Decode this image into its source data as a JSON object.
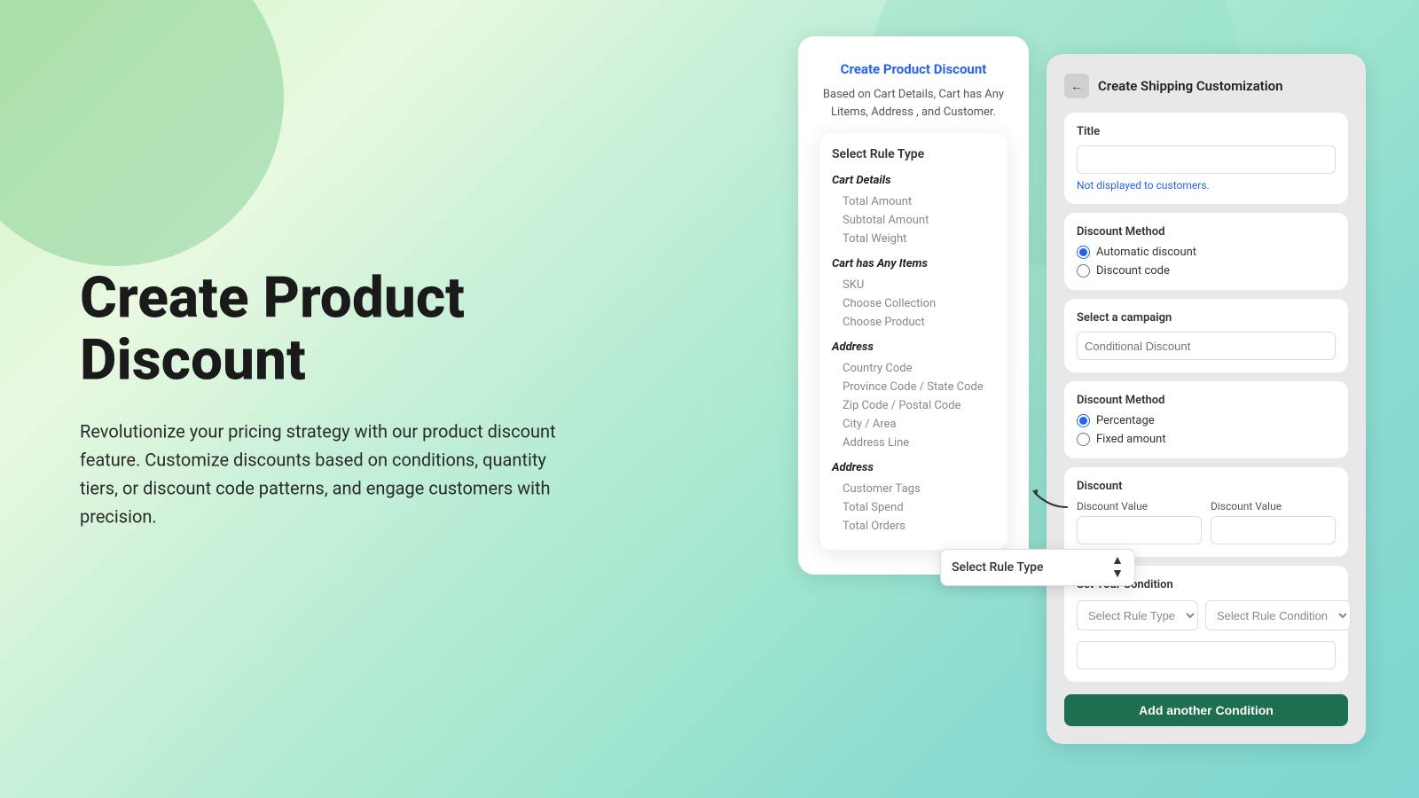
{
  "background": {
    "gradient": "linear-gradient(135deg, #d4f5c4, #7dd4d0)"
  },
  "left_section": {
    "heading": "Create Product Discount",
    "description": "Revolutionize your pricing strategy with our product discount feature. Customize discounts based on conditions, quantity tiers, or discount code patterns, and engage customers with precision."
  },
  "product_card": {
    "title": "Create Product Discount",
    "description": "Based on Cart Details, Cart has Any Litems, Address , and Customer."
  },
  "rule_type_card": {
    "section_title": "Select Rule Type",
    "categories": [
      {
        "label": "Cart Details",
        "items": [
          "Total Amount",
          "Subtotal Amount",
          "Total Weight"
        ]
      },
      {
        "label": "Cart has Any Items",
        "items": [
          "SKU",
          "Choose Collection",
          "Choose Product"
        ]
      },
      {
        "label": "Address",
        "items": [
          "Country Code",
          "Province Code / State Code",
          "Zip Code / Postal Code",
          "City / Area",
          "Address Line"
        ]
      },
      {
        "label": "Address",
        "items": [
          "Customer Tags",
          "Total Spend",
          "Total Orders"
        ]
      }
    ]
  },
  "shipping_panel": {
    "back_icon": "←",
    "title": "Create Shipping Customization",
    "title_section": {
      "label": "Title",
      "input_value": "",
      "not_displayed_text": "Not displayed to customers."
    },
    "discount_method_section": {
      "label": "Discount Method",
      "options": [
        "Automatic discount",
        "Discount code"
      ],
      "selected": "Automatic discount"
    },
    "campaign_section": {
      "label": "Select a campaign",
      "placeholder": "Conditional Discount"
    },
    "discount_method_2_section": {
      "label": "Discount Method",
      "options": [
        "Percentage",
        "Fixed amount"
      ],
      "selected": "Percentage"
    },
    "discount_section": {
      "label": "Discount",
      "field1_label": "Discount Value",
      "field1_value": "",
      "field2_label": "Discount Value",
      "field2_value": ""
    },
    "condition_section": {
      "label": "Set Your Condition",
      "rule_type_placeholder": "Select Rule Type",
      "condition_placeholder": "Select Rule Condition",
      "text_input_value": "",
      "add_button_label": "Add another Condition"
    }
  },
  "rule_type_dropdown": {
    "placeholder": "Select Rule Type",
    "arrow_up": "▲",
    "arrow_down": "▼"
  }
}
